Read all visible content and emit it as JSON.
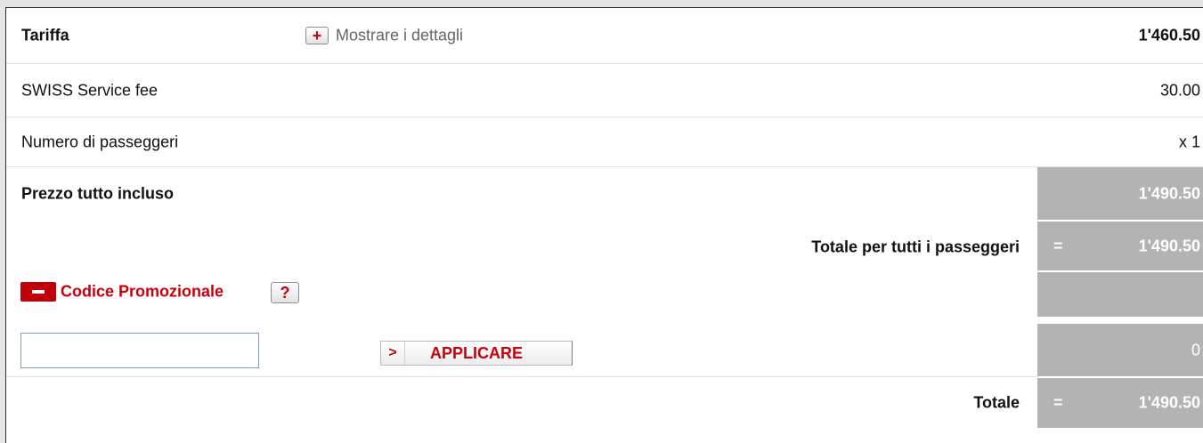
{
  "fare": {
    "label": "Tariffa",
    "details_link": "Mostrare i dettagli",
    "value": "1'460.50"
  },
  "service_fee": {
    "label": "SWISS Service fee",
    "value": "30.00"
  },
  "passengers": {
    "label": "Numero di passeggeri",
    "value": "x 1"
  },
  "all_inclusive": {
    "label": "Prezzo tutto incluso",
    "value": "1'490.50"
  },
  "total_all_passengers": {
    "label": "Totale per tutti i passeggeri",
    "equals": "=",
    "value": "1'490.50"
  },
  "promo": {
    "label": "Codice Promozionale",
    "help": "?",
    "input_value": "",
    "apply_button": "APPLICARE",
    "apply_chevron": ">",
    "discount_value": "0"
  },
  "grand_total": {
    "label": "Totale",
    "equals": "=",
    "value": "1'490.50"
  },
  "colors": {
    "accent_red": "#c8000b",
    "grey_cell": "#b3b3b3"
  }
}
